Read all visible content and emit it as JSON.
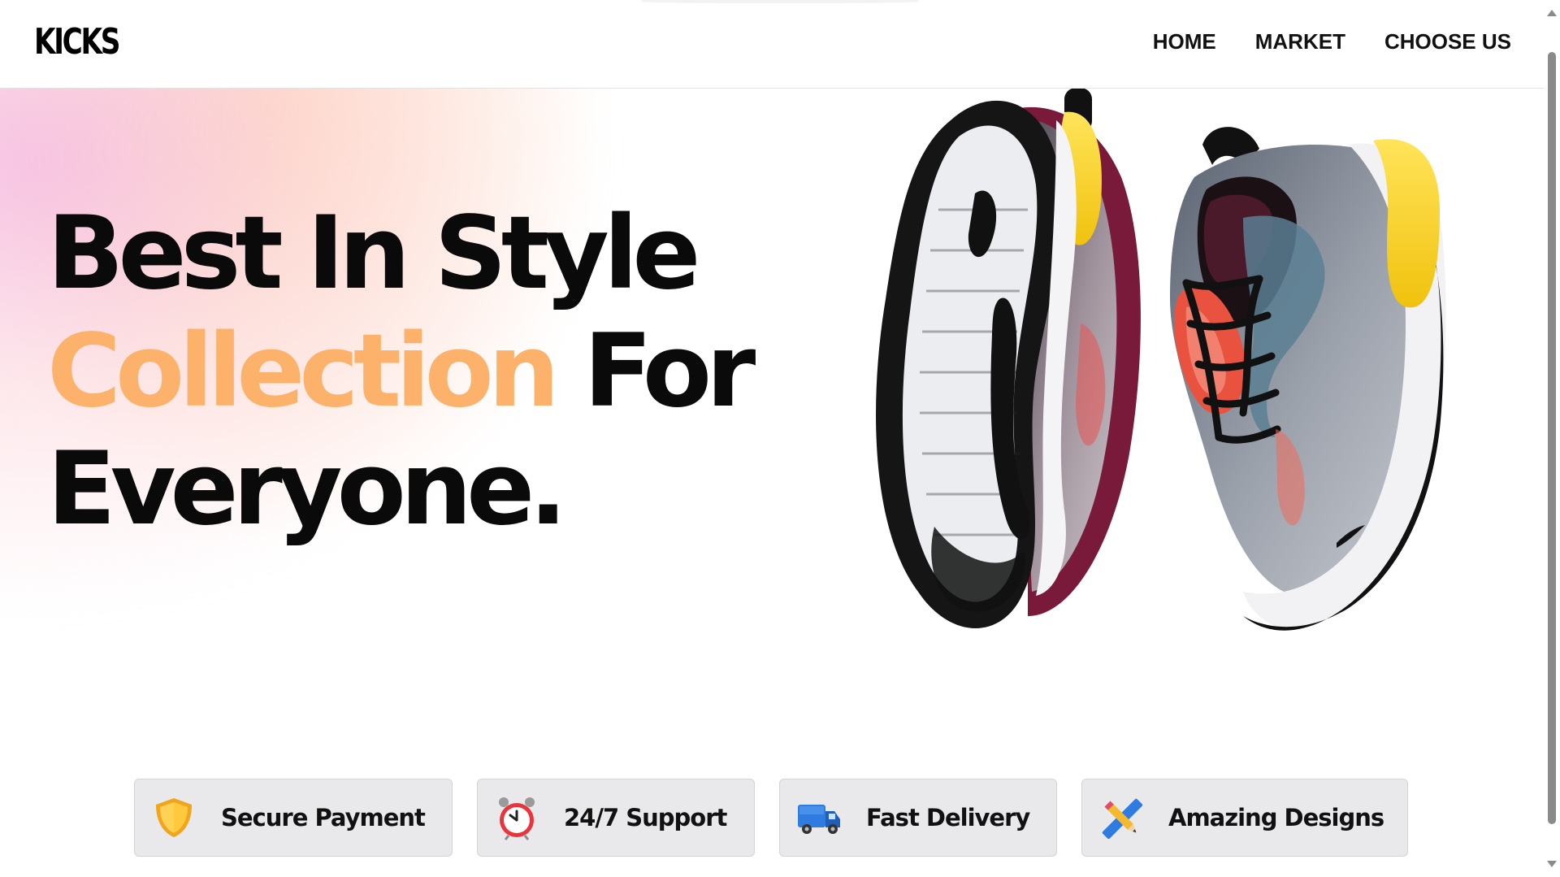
{
  "header": {
    "logo": "KICKS",
    "nav": [
      {
        "label": "HOME"
      },
      {
        "label": "MARKET"
      },
      {
        "label": "CHOOSE US"
      }
    ]
  },
  "hero": {
    "line1": "Best In Style",
    "line2_accent": "Collection",
    "line2_rest": " For",
    "line3": "Everyone.",
    "accent_color": "#fdb26b"
  },
  "features": [
    {
      "label": "Secure Payment",
      "icon": "shield-icon"
    },
    {
      "label": "24/7 Support",
      "icon": "alarm-clock-icon"
    },
    {
      "label": "Fast Delivery",
      "icon": "delivery-truck-icon"
    },
    {
      "label": "Amazing Designs",
      "icon": "pencil-ruler-icon"
    }
  ],
  "colors": {
    "card_bg": "#e9e9ec",
    "text": "#111111",
    "accent": "#fdb26b",
    "sole_yellow": "#f6d21b"
  }
}
